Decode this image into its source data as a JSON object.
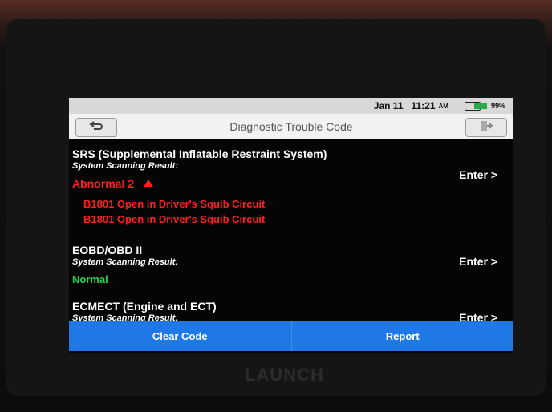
{
  "status_bar": {
    "date": "Jan 11",
    "time": "11:21",
    "ampm": "AM",
    "battery_percent": "99%",
    "battery_fill_fraction": 0.99,
    "battery_color": "#27a94b"
  },
  "header": {
    "title": "Diagnostic Trouble Code",
    "back_icon": "return-arrow-icon",
    "exit_icon": "exit-icon"
  },
  "systems": [
    {
      "name": "SRS (Supplemental Inflatable Restraint System)",
      "subtitle": "System Scanning Result:",
      "enter_label": "Enter >",
      "status": "Abnormal 2",
      "status_color": "#ff1f1f",
      "codes": [
        "B1801 Open in Driver's Squib Circuit",
        "B1801 Open in Driver's Squib Circuit"
      ]
    },
    {
      "name": "EOBD/OBD II",
      "subtitle": "System Scanning Result:",
      "enter_label": "Enter >",
      "status": "Normal",
      "status_color": "#24d24a"
    },
    {
      "name": "ECMECT (Engine and ECT)",
      "subtitle": "System Scanning Result:",
      "enter_label": "Enter >"
    }
  ],
  "bottom_bar": {
    "clear_code": "Clear Code",
    "report": "Report",
    "accent": "#1e78e6"
  },
  "brand": "LAUNCH"
}
